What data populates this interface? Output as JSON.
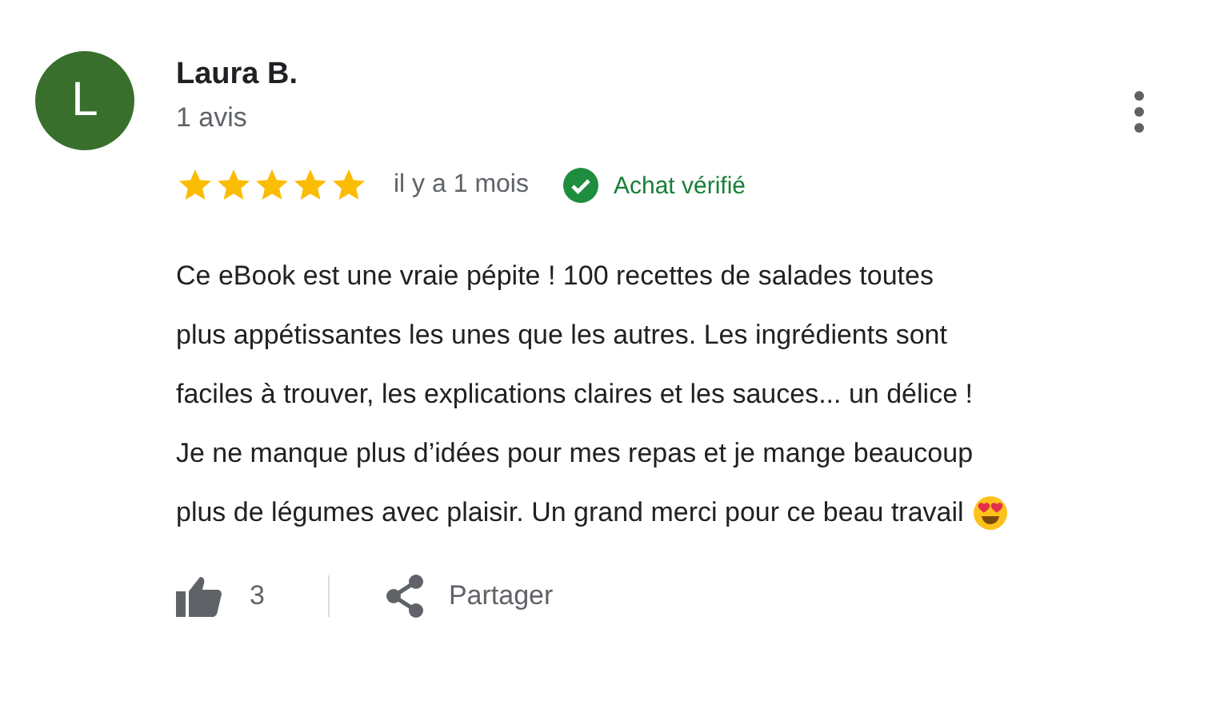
{
  "review": {
    "avatar_letter": "L",
    "author": "Laura B.",
    "review_count": "1 avis",
    "stars": 5,
    "date": "il y a 1 mois",
    "verified": true,
    "verified_label": "Achat vérifié",
    "text_lines": [
      "Ce eBook est une vraie pépite ! 100 recettes de salades toutes",
      "plus appétissantes les unes que les autres. Les ingrédients sont",
      "faciles à trouver, les explications claires et les sauces... un délice !",
      "Je ne manque plus d’idées pour mes repas et je mange beaucoup",
      "plus de légumes avec plaisir. Un grand merci pour ce beau travail"
    ],
    "likes": "3",
    "share_label": "Partager"
  }
}
